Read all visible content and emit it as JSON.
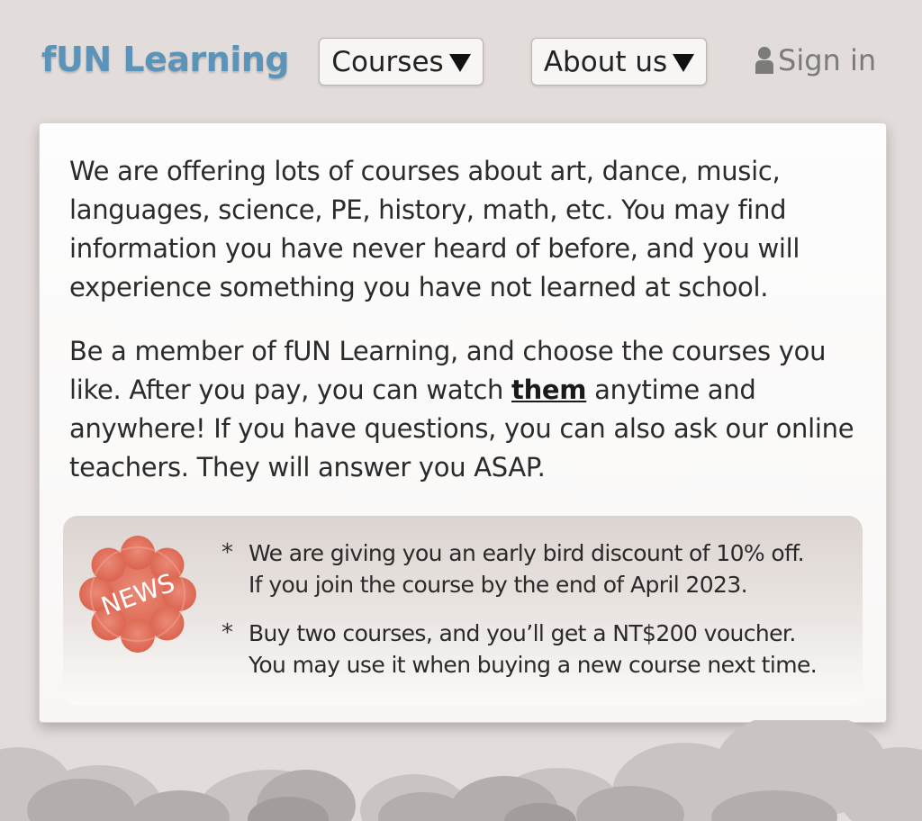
{
  "header": {
    "logo": "fUN Learning",
    "nav": [
      {
        "label": "Courses"
      },
      {
        "label": "About us"
      }
    ],
    "signin_label": "Sign in"
  },
  "content": {
    "para1": "We are offering lots of courses about art, dance, music, languages, science, PE, history, math, etc. You may find information you have never heard of before, and you will experience something you have not learned at school.",
    "para2_before": "Be a member of fUN Learning, and choose the courses you like. After you pay, you can watch ",
    "para2_link": "them",
    "para2_after": " anytime and anywhere! If you have questions, you can also ask our online teachers. They will answer you ASAP."
  },
  "news": {
    "badge_label": "NEWS",
    "bullet": "*",
    "items": [
      {
        "line1": "We are giving you an early bird discount of 10% off.",
        "line2": "If you join the course by the end of April 2023."
      },
      {
        "line1": "Buy two courses, and you’ll get a NT$200 voucher.",
        "line2": "You may use it when buying a new course next time."
      }
    ]
  },
  "colors": {
    "background": "#e2dcda",
    "logo": "#5b93b9",
    "badge": "#e0705a",
    "card": "#fdfdfd"
  },
  "icons": {
    "signin": "user-icon",
    "dropdown": "triangle-down-icon",
    "news": "flower-badge-icon"
  }
}
